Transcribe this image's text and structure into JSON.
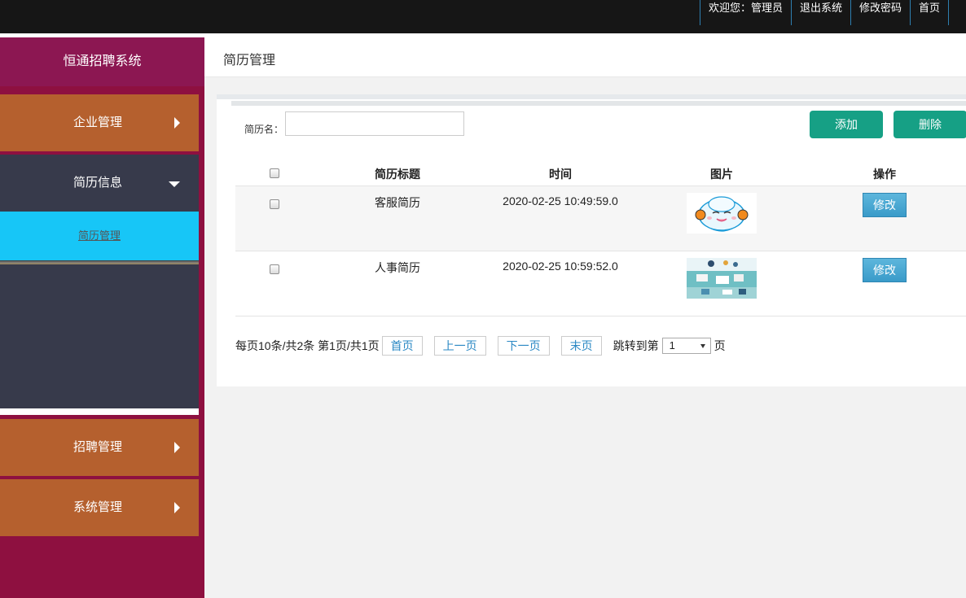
{
  "topnav": {
    "welcome": "欢迎您：管理员",
    "logout": "退出系统",
    "change_password": "修改密码",
    "home": "首页"
  },
  "sidebar": {
    "brand": "恒通招聘系统",
    "items": [
      {
        "label": "企业管理",
        "expanded": false
      },
      {
        "label": "简历信息",
        "expanded": true,
        "children": [
          {
            "label": "简历管理",
            "active": true
          }
        ]
      },
      {
        "label": "招聘管理",
        "expanded": false
      },
      {
        "label": "系统管理",
        "expanded": false
      }
    ]
  },
  "page": {
    "title": "简历管理"
  },
  "search": {
    "label": "简历名：",
    "value": ""
  },
  "actions": {
    "add": "添加",
    "delete": "删除"
  },
  "table": {
    "columns": [
      "简历标题",
      "时间",
      "图片",
      "操作"
    ],
    "rows": [
      {
        "title": "客服简历",
        "time": "2020-02-25 10:49:59.0",
        "image": "cartoon-headphones-avatar-icon",
        "action": "修改"
      },
      {
        "title": "人事简历",
        "time": "2020-02-25 10:59:52.0",
        "image": "office-desk-photo-icon",
        "action": "修改"
      }
    ]
  },
  "pager": {
    "summary": "每页10条/共2条 第1页/共1页",
    "first": "首页",
    "prev": "上一页",
    "next": "下一页",
    "last": "末页",
    "jump_prefix": "跳转到第",
    "jump_value": "1",
    "jump_suffix": "页"
  },
  "colors": {
    "topbar": "#161616",
    "sidebar_bg": "#8e1040",
    "menu": "#b5602e",
    "menu_active": "#373a4b",
    "sub_active": "#17c6f7",
    "green_button": "#16a085",
    "edit_button": "#3a9bc9"
  }
}
